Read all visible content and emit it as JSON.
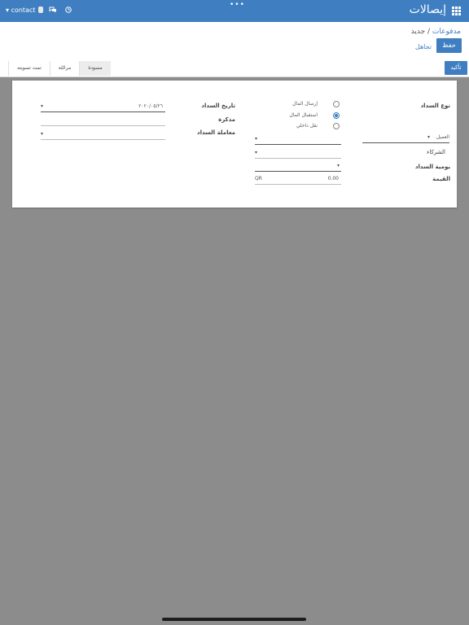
{
  "topbar": {
    "app_title": "إيصالات",
    "dots": "•••",
    "user_name": "contact",
    "user_caret": "▾"
  },
  "breadcrumb": {
    "parent": "مدفوعات",
    "sep": " / ",
    "current": "جديد"
  },
  "toolbar": {
    "save_label": "حفظ",
    "discard_label": "تجاهل"
  },
  "statusbar": {
    "confirm_label": "تأكيد",
    "stages": [
      {
        "label": "مسودة",
        "active": true
      },
      {
        "label": "مرحّلة",
        "active": false
      },
      {
        "label": "تمت تسويته",
        "active": false
      }
    ]
  },
  "form": {
    "payment_type_label": "نوع السداد",
    "payment_types": [
      {
        "label": "إرسال المال",
        "checked": false
      },
      {
        "label": "استقبال المال",
        "checked": true
      },
      {
        "label": "نقل داخلي",
        "checked": false
      }
    ],
    "partner_type_value": "العميل",
    "partner_label": "الشركاء",
    "journal_label": "يومية السداد",
    "amount_label": "القيمة",
    "amount_value": "0.00",
    "currency": "QR",
    "date_label": "تاريخ السداد",
    "date_value": "٢٠٢٠/٠٥/٢٦",
    "memo_label": "مذكرة",
    "transaction_label": "معاملة السداد"
  }
}
